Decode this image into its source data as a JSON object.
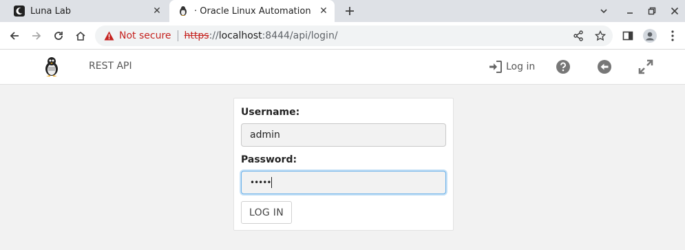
{
  "browser": {
    "tabs": [
      {
        "title": "Luna Lab",
        "active": false
      },
      {
        "title": "· Oracle Linux Automation",
        "active": true
      }
    ],
    "address": {
      "security_label": "Not secure",
      "scheme": "https",
      "sep": "://",
      "host": "localhost",
      "rest": ":8444/api/login/"
    },
    "colors": {
      "warning": "#c5221f"
    }
  },
  "appbar": {
    "logo": "tux-penguin-logo",
    "brand_link": "REST API",
    "login_label": "Log in",
    "icons": [
      "help-circle-icon",
      "back-circle-icon",
      "expand-icon"
    ]
  },
  "login_form": {
    "username_label": "Username:",
    "username_value": "admin",
    "password_label": "Password:",
    "password_value": "•••••",
    "submit_label": "LOG IN"
  }
}
